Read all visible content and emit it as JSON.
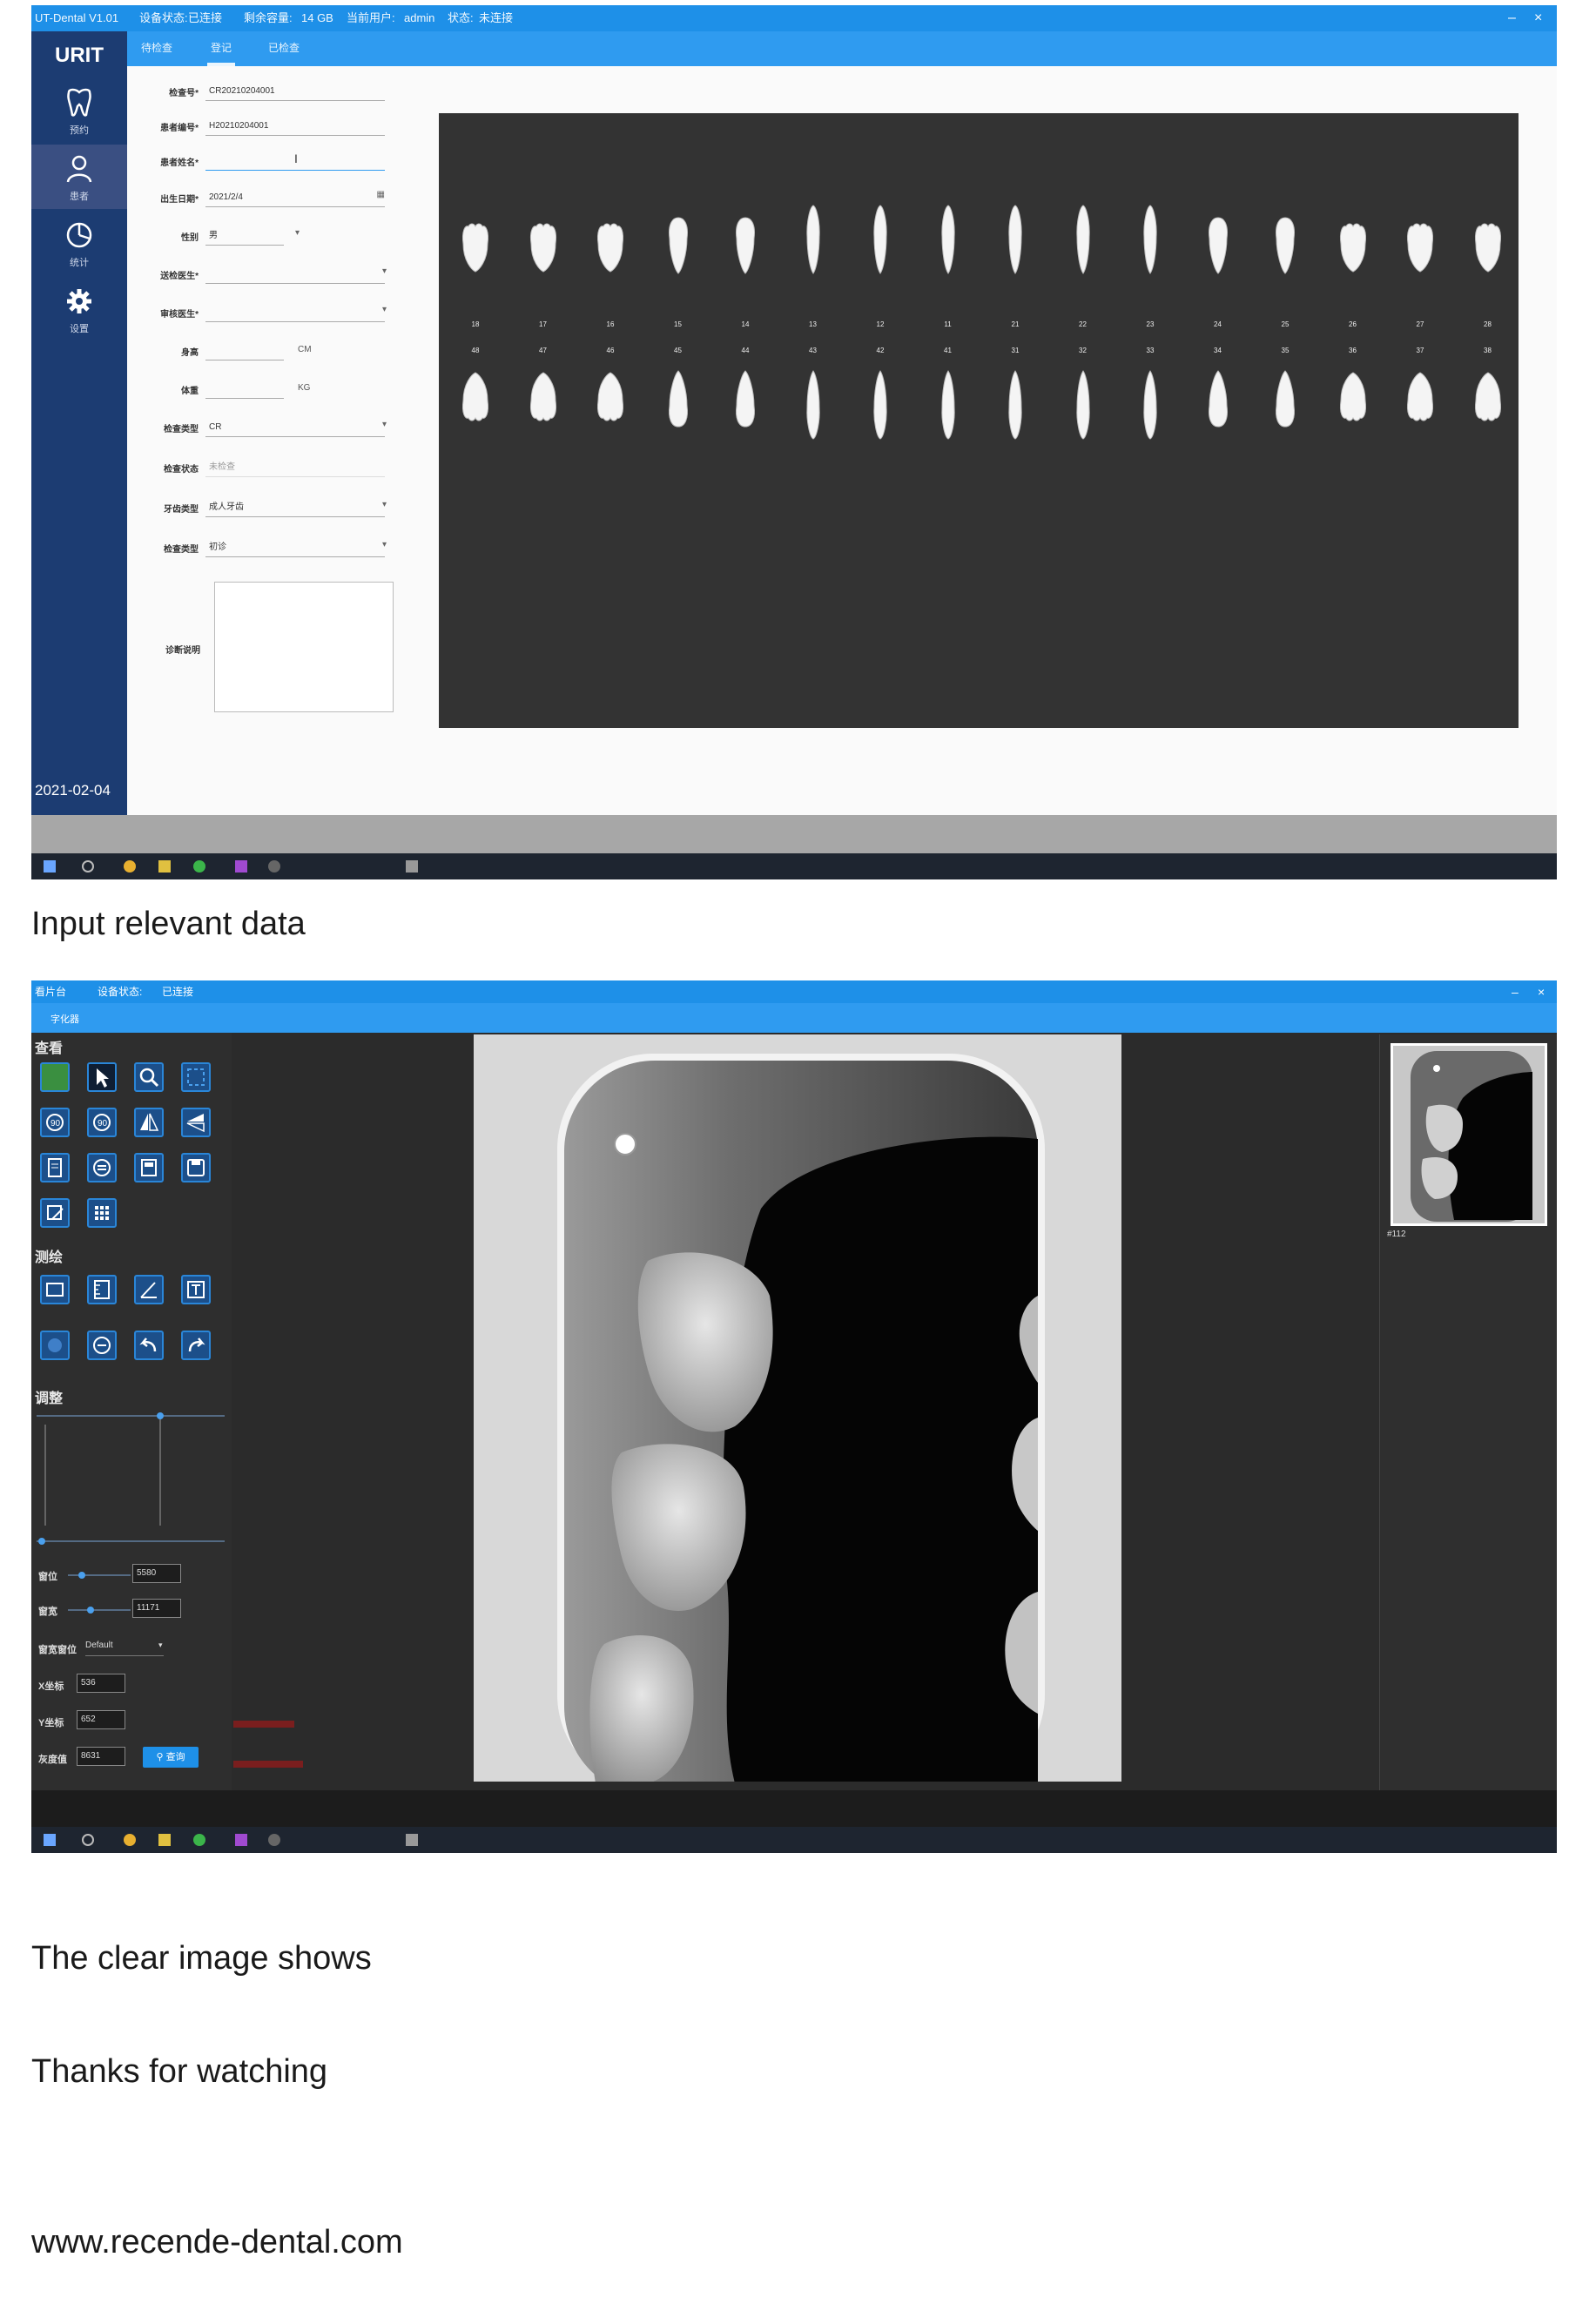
{
  "screenshot1": {
    "title": "UT-Dental V1.01",
    "status_items": [
      "设备状态:",
      "已连接",
      "剩余容量:",
      "14 GB",
      "当前用户:",
      "admin",
      "状态:",
      "未连接"
    ],
    "tabs": [
      "待检查",
      "登记",
      "已检查"
    ],
    "sidebar": {
      "logo": "URIT",
      "items": [
        {
          "label": "预约",
          "icon": "tooth-icon"
        },
        {
          "label": "患者",
          "icon": "user-icon"
        },
        {
          "label": "统计",
          "icon": "pie-chart-icon"
        },
        {
          "label": "设置",
          "icon": "gear-icon"
        }
      ],
      "date": "2021-02-04"
    },
    "form": {
      "exam_no_label": "检查号*",
      "exam_no": "CR20210204001",
      "patient_id_label": "患者编号*",
      "patient_id": "H20210204001",
      "name_label": "患者姓名*",
      "name": "",
      "birth_label": "出生日期*",
      "birth": "2021/2/4",
      "sex_label": "性别",
      "sex": "男",
      "doctor1_label": "送检医生*",
      "doctor1": "",
      "doctor2_label": "审核医生*",
      "doctor2": "",
      "height_label": "身高",
      "height": "",
      "height_unit": "CM",
      "weight_label": "体重",
      "weight": "",
      "weight_unit": "KG",
      "exam_type_label": "检查类型",
      "exam_type": "CR",
      "status_label": "检查状态",
      "status": "未检查",
      "tooth_type_label": "牙齿类型",
      "tooth_type": "成人牙齿",
      "exam_kind_label": "检查类型",
      "exam_kind": "初诊",
      "notes_label": "诊断说明"
    },
    "teeth_upper": [
      "18",
      "17",
      "16",
      "15",
      "14",
      "13",
      "12",
      "11",
      "21",
      "22",
      "23",
      "24",
      "25",
      "26",
      "27",
      "28"
    ],
    "teeth_lower": [
      "48",
      "47",
      "46",
      "45",
      "44",
      "43",
      "42",
      "41",
      "31",
      "32",
      "33",
      "34",
      "35",
      "36",
      "37",
      "38"
    ]
  },
  "captions": {
    "first": "Input relevant data",
    "second": "The clear image shows",
    "third": "Thanks for watching",
    "url": "www.recende-dental.com"
  },
  "screenshot2": {
    "title": "看片台",
    "status_label": "设备状态:",
    "status_value": "已连接",
    "subtab": "字化器",
    "sections": {
      "view": "查看",
      "measure": "测绘",
      "adjust": "调整"
    },
    "adjust": {
      "window_label": "窗位",
      "window_value": "5580",
      "width_label": "窗宽",
      "width_value": "11171",
      "lut_label": "窗宽窗位",
      "lut_value": "Default",
      "x_label": "X坐标",
      "x_value": "536",
      "y_label": "Y坐标",
      "y_value": "652",
      "gray_label": "灰度值",
      "gray_value": "8631",
      "search_label": "查询"
    },
    "thumb_label": "#112",
    "colors": {
      "accent": "#1e90e8",
      "tool_border": "#2a86d8"
    }
  }
}
